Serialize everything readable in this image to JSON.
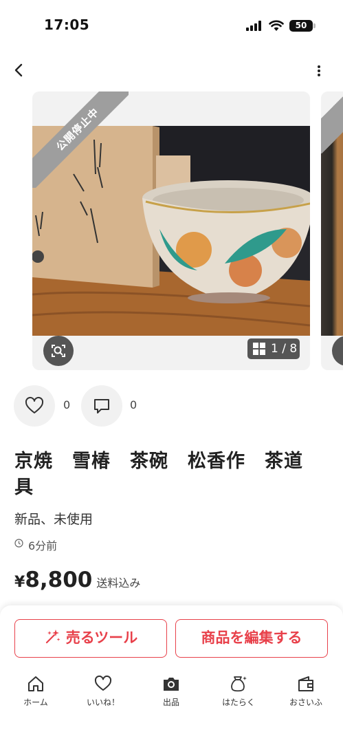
{
  "status_bar": {
    "time": "17:05",
    "battery": "50"
  },
  "photo": {
    "ribbon": "公開停止中",
    "counter": "1 / 8"
  },
  "reactions": {
    "likes": "0",
    "comments": "0"
  },
  "item": {
    "title": "京焼　雪椿　茶碗　松香作　茶道具",
    "condition": "新品、未使用",
    "posted": "6分前",
    "price_symbol": "¥",
    "price": "8,800",
    "shipping": "送料込み"
  },
  "actions": {
    "sell_tool": "売るツール",
    "edit_item": "商品を編集する"
  },
  "tabs": [
    {
      "label": "ホーム",
      "icon": "home-icon"
    },
    {
      "label": "いいね！",
      "icon": "heart-icon"
    },
    {
      "label": "出品",
      "icon": "camera-icon"
    },
    {
      "label": "はたらく",
      "icon": "money-bag-icon"
    },
    {
      "label": "おさいふ",
      "icon": "wallet-icon"
    }
  ],
  "colors": {
    "accent": "#e8404a",
    "ribbon": "#9e9e9e",
    "badge": "#555555"
  }
}
